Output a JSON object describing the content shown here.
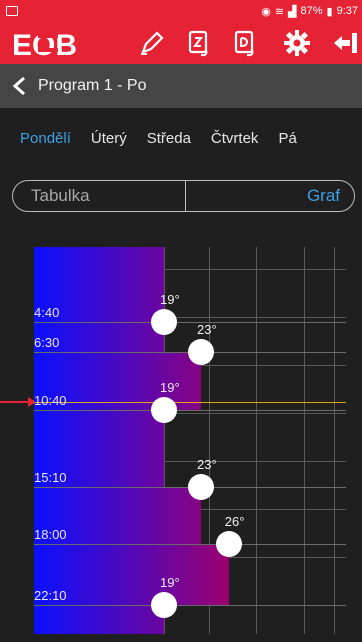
{
  "status_bar": {
    "battery_percent": "87%",
    "time": "9:37",
    "icons": [
      "notification-icon",
      "alarm-icon",
      "wifi-icon",
      "signal-icon",
      "battery-icon"
    ]
  },
  "toolbar": {
    "logo_text": "EOB",
    "icons": [
      "pencil-icon",
      "z-document-icon",
      "d-document-icon",
      "gear-icon",
      "logout-icon"
    ]
  },
  "title": "Program 1 - Po",
  "days": [
    "Pondělí",
    "Úterý",
    "Středa",
    "Čtvrtek",
    "Pá"
  ],
  "active_day": "Pondělí",
  "segmented": {
    "left": "Tabulka",
    "right": "Graf",
    "selected": "Graf"
  },
  "chart_data": {
    "type": "area",
    "schedule": [
      {
        "time": "4:40",
        "temp": "19°",
        "value": 19
      },
      {
        "time": "6:30",
        "temp": "23°",
        "value": 23
      },
      {
        "time": "10:40",
        "temp": "19°",
        "value": 19
      },
      {
        "time": "15:10",
        "temp": "23°",
        "value": 23
      },
      {
        "time": "18:00",
        "temp": "26°",
        "value": 26
      },
      {
        "time": "22:10",
        "temp": "19°",
        "value": 19
      }
    ],
    "colors": {
      "low": "#0a10ff",
      "high": "#a0006a",
      "now_line": "#e0a020"
    }
  }
}
